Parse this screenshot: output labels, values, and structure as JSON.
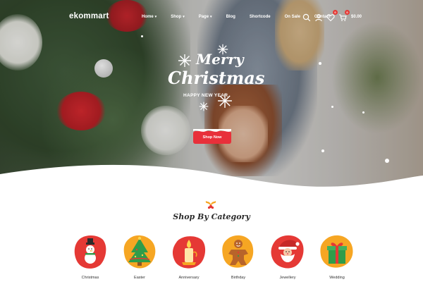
{
  "header": {
    "logo": "ekommart",
    "menu": [
      {
        "label": "Home",
        "has_dropdown": true
      },
      {
        "label": "Shop",
        "has_dropdown": true
      },
      {
        "label": "Page",
        "has_dropdown": true
      },
      {
        "label": "Blog",
        "has_dropdown": false
      },
      {
        "label": "Shortcode",
        "has_dropdown": false
      },
      {
        "label": "On Sale",
        "has_dropdown": false
      },
      {
        "label": "Contact",
        "has_dropdown": false
      }
    ],
    "icons": [
      "search-icon",
      "user-icon",
      "heart-icon",
      "cart-icon"
    ],
    "wishlist_count": "0",
    "cart_count": "0",
    "cart_total": "$0.00"
  },
  "hero": {
    "title_line1": "Merry",
    "title_line2": "Christmas",
    "subtitle": "HAPPY NEW YEAR",
    "button_label": "Shop Now"
  },
  "categories": {
    "heading": "Shop By Category",
    "items": [
      {
        "label": "Christmas",
        "icon": "snowman-icon",
        "color": "#e53935"
      },
      {
        "label": "Easter",
        "icon": "christmas-tree-icon",
        "color": "#f6a623"
      },
      {
        "label": "Anniversary",
        "icon": "candle-icon",
        "color": "#e53935"
      },
      {
        "label": "Birthday",
        "icon": "gingerbread-icon",
        "color": "#f6a623"
      },
      {
        "label": "Jewellery",
        "icon": "santa-icon",
        "color": "#e53935"
      },
      {
        "label": "Wedding",
        "icon": "gift-icon",
        "color": "#f6a623"
      }
    ]
  },
  "colors": {
    "accent": "#e8303a",
    "secondary": "#f6a623"
  }
}
